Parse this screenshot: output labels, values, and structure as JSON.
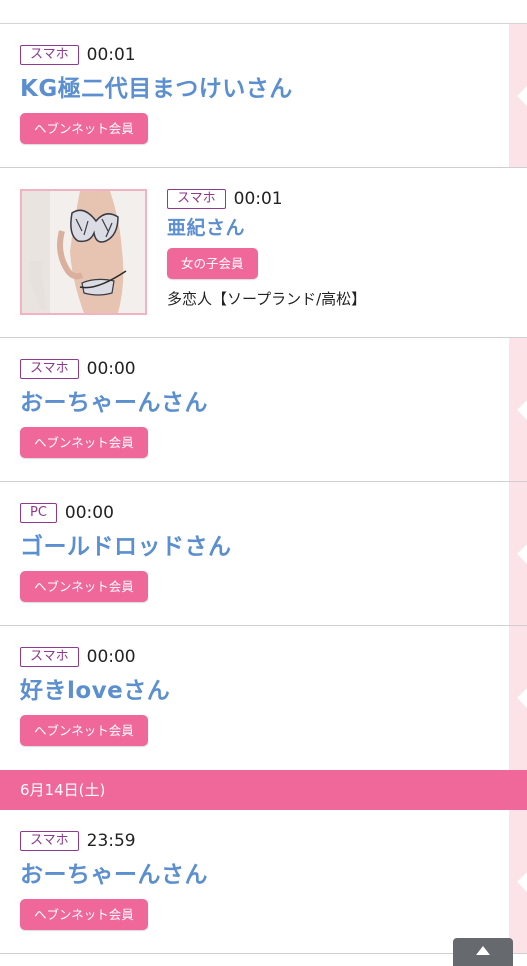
{
  "entries_before": [
    {
      "device": "スマホ",
      "time": "00:01",
      "name": "KG極二代目まつけいさん",
      "member": "ヘブンネット会員"
    }
  ],
  "girl_entry": {
    "device": "スマホ",
    "time": "00:01",
    "name": "亜紀さん",
    "member": "女の子会員",
    "shop": "多恋人【ソープランド/高松】"
  },
  "entries_after": [
    {
      "device": "スマホ",
      "time": "00:00",
      "name": "おーちゃーんさん",
      "member": "ヘブンネット会員"
    },
    {
      "device": "PC",
      "time": "00:00",
      "name": "ゴールドロッドさん",
      "member": "ヘブンネット会員"
    },
    {
      "device": "スマホ",
      "time": "00:00",
      "name": "好きloveさん",
      "member": "ヘブンネット会員"
    }
  ],
  "date_header": "6月14日(土)",
  "entries_next_day": [
    {
      "device": "スマホ",
      "time": "23:59",
      "name": "おーちゃーんさん",
      "member": "ヘブンネット会員"
    }
  ],
  "colors": {
    "accent_pink": "#f0679a",
    "name_blue": "#5b8fcf",
    "badge_purple": "#8e3a8e",
    "side_tab_pink": "#fbe3e8"
  },
  "icons": {
    "scroll_top": "arrow-up-icon"
  }
}
